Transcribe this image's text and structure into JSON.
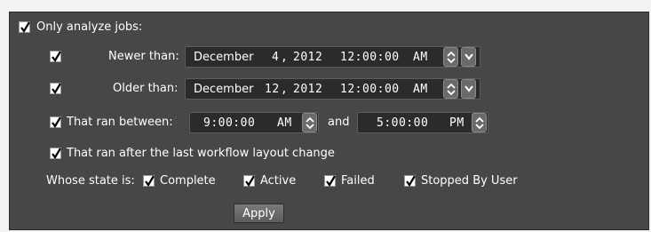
{
  "filter": {
    "only_analyze_label": "Only analyze jobs:",
    "newer_than": {
      "label": "Newer than:",
      "month": "December",
      "day": "4",
      "year": "2012",
      "time": "12:00:00",
      "ampm": "AM"
    },
    "older_than": {
      "label": "Older than:",
      "month": "December",
      "day": "12",
      "year": "2012",
      "time": "12:00:00",
      "ampm": "AM"
    },
    "ran_between": {
      "label": "That ran between:",
      "start_time": "9:00:00",
      "start_ampm": "AM",
      "and_label": "and",
      "end_time": "5:00:00",
      "end_ampm": "PM"
    },
    "after_layout_change_label": "That ran after the last workflow layout change",
    "state": {
      "label": "Whose state is:",
      "options": [
        "Complete",
        "Active",
        "Failed",
        "Stopped By User"
      ]
    },
    "apply_label": "Apply"
  },
  "colors": {
    "panel": "#474747",
    "field": "#2b2b2b",
    "text": "#ffffff"
  }
}
